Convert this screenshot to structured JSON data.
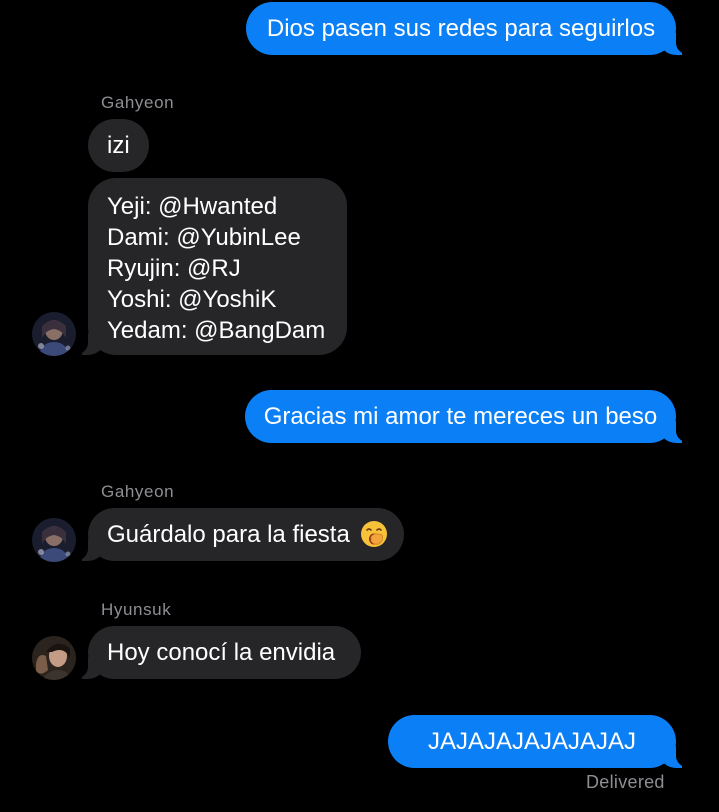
{
  "conversation": {
    "messages": [
      {
        "direction": "outgoing",
        "text": "Dios pasen sus redes para seguirlos"
      },
      {
        "direction": "incoming",
        "sender": "Gahyeon",
        "text": "izi"
      },
      {
        "direction": "incoming",
        "sender": "Gahyeon",
        "lines": [
          "Yeji: @Hwanted",
          "Dami: @YubinLee",
          "Ryujin: @RJ",
          "Yoshi: @YoshiK",
          "Yedam: @BangDam"
        ]
      },
      {
        "direction": "outgoing",
        "text": "Gracias mi amor te mereces un beso"
      },
      {
        "direction": "incoming",
        "sender": "Gahyeon",
        "text": "Guárdalo para la fiesta",
        "emoji": "yawning-face"
      },
      {
        "direction": "incoming",
        "sender": "Hyunsuk",
        "text": "Hoy conocí la envidia"
      },
      {
        "direction": "outgoing",
        "text": "JAJAJAJAJAJAJAJ"
      }
    ],
    "status": "Delivered"
  },
  "colors": {
    "background": "#000000",
    "outgoing_bubble": "#0b7ff5",
    "incoming_bubble": "#262629",
    "sender_name": "#8e8e93",
    "status_text": "#8e8e93"
  },
  "icons": {
    "avatar_gahyeon": "avatar",
    "avatar_hyunsuk": "avatar",
    "emoji": "yawning-face-emoji"
  }
}
